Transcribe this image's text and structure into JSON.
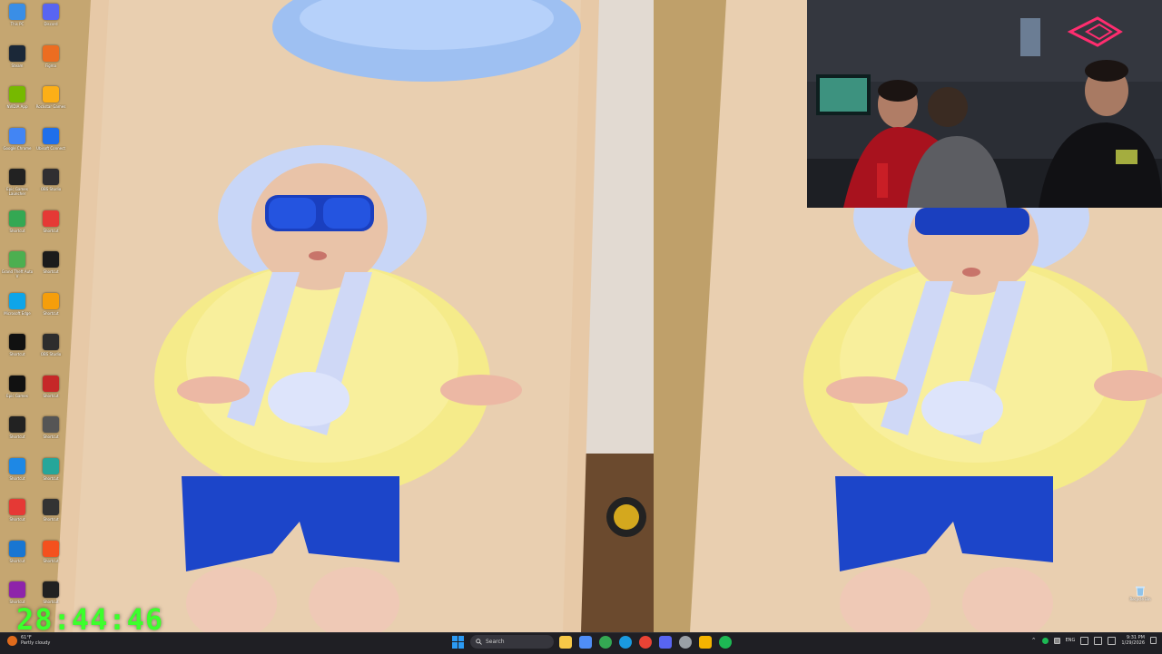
{
  "desktop": {
    "icons": [
      {
        "label": "This PC",
        "color": "#3a8ee6"
      },
      {
        "label": "Discord",
        "color": "#5865f2"
      },
      {
        "label": "Steam",
        "color": "#1b2838"
      },
      {
        "label": "Figma",
        "color": "#ec6d21"
      },
      {
        "label": "NVIDIA App",
        "color": "#76b900"
      },
      {
        "label": "Rockstar Games",
        "color": "#fcaf17"
      },
      {
        "label": "Google Chrome",
        "color": "#4285f4"
      },
      {
        "label": "Ubisoft Connect",
        "color": "#1f6feb"
      },
      {
        "label": "Epic Games Launcher",
        "color": "#222222"
      },
      {
        "label": "OBS Studio",
        "color": "#302e31"
      },
      {
        "label": "Shortcut",
        "color": "#34a853"
      },
      {
        "label": "Shortcut",
        "color": "#e53935"
      },
      {
        "label": "Grand Theft Auto V",
        "color": "#4caf50"
      },
      {
        "label": "Shortcut",
        "color": "#1b1b1b"
      },
      {
        "label": "Microsoft Edge",
        "color": "#0ea5e9"
      },
      {
        "label": "Shortcut",
        "color": "#f59e0b"
      },
      {
        "label": "Shortcut",
        "color": "#111111"
      },
      {
        "label": "OBS Studio",
        "color": "#2d2d2d"
      },
      {
        "label": "Epic Games",
        "color": "#111111"
      },
      {
        "label": "Shortcut",
        "color": "#c62828"
      },
      {
        "label": "Shortcut",
        "color": "#222222"
      },
      {
        "label": "Shortcut",
        "color": "#555555"
      },
      {
        "label": "Shortcut",
        "color": "#1e88e5"
      },
      {
        "label": "Shortcut",
        "color": "#26a69a"
      },
      {
        "label": "Shortcut",
        "color": "#e53935"
      },
      {
        "label": "Shortcut",
        "color": "#333333"
      },
      {
        "label": "Shortcut",
        "color": "#1976d2"
      },
      {
        "label": "Shortcut",
        "color": "#f4511e"
      },
      {
        "label": "Shortcut",
        "color": "#8e24aa"
      },
      {
        "label": "Shortcut",
        "color": "#212121"
      }
    ],
    "recycle_bin_label": "Recycle Bin",
    "timer": "28:44:46"
  },
  "taskbar": {
    "weather_temp": "61°F",
    "weather_desc": "Partly cloudy",
    "search_placeholder": "Search",
    "pinned_apps": [
      {
        "name": "file-explorer-icon",
        "color": "#f7c948"
      },
      {
        "name": "copilot-icon",
        "color": "#4f8ef7"
      },
      {
        "name": "chrome-icon",
        "color": "#34a853"
      },
      {
        "name": "edge-icon",
        "color": "#1a9ae0"
      },
      {
        "name": "chrome-alt-icon",
        "color": "#ea4335"
      },
      {
        "name": "discord-icon",
        "color": "#5865f2"
      },
      {
        "name": "settings-icon",
        "color": "#9aa0a6"
      },
      {
        "name": "folder-icon",
        "color": "#f4b400"
      },
      {
        "name": "spotify-icon",
        "color": "#1db954"
      }
    ],
    "language": "ENG",
    "time": "9:31 PM",
    "date": "1/29/2026"
  }
}
